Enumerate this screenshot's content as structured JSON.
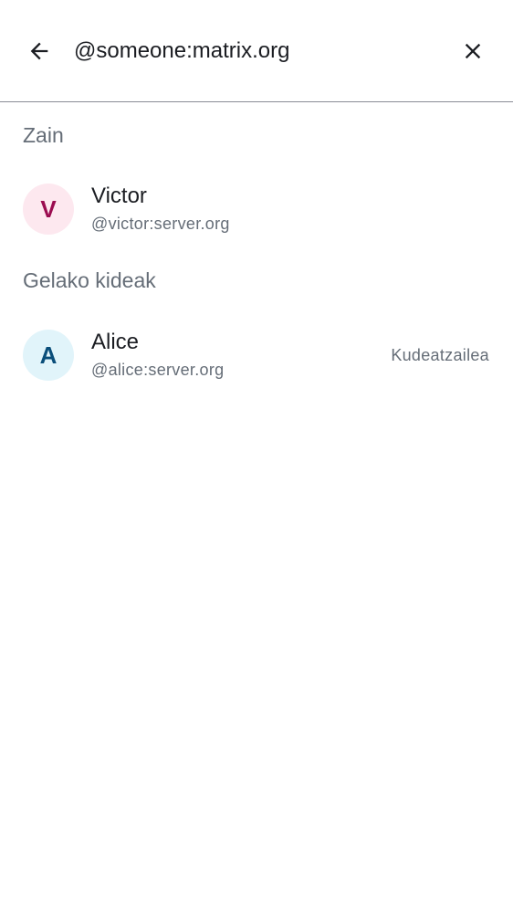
{
  "search": {
    "value": "@someone:matrix.org",
    "back_icon": "arrow-left-icon",
    "clear_icon": "close-icon"
  },
  "sections": [
    {
      "title": "Zain",
      "members": [
        {
          "initial": "V",
          "name": "Victor",
          "user_id": "@victor:server.org",
          "role": "",
          "avatar_bg": "#fde8ef",
          "avatar_fg": "#9b0c50"
        }
      ]
    },
    {
      "title": "Gelako kideak",
      "members": [
        {
          "initial": "A",
          "name": "Alice",
          "user_id": "@alice:server.org",
          "role": "Kudeatzailea",
          "avatar_bg": "#e1f4fa",
          "avatar_fg": "#0a4e7a"
        }
      ]
    }
  ],
  "colors": {
    "text_primary": "#1b1d22",
    "text_secondary": "#656d77",
    "divider": "#8a8d96"
  }
}
